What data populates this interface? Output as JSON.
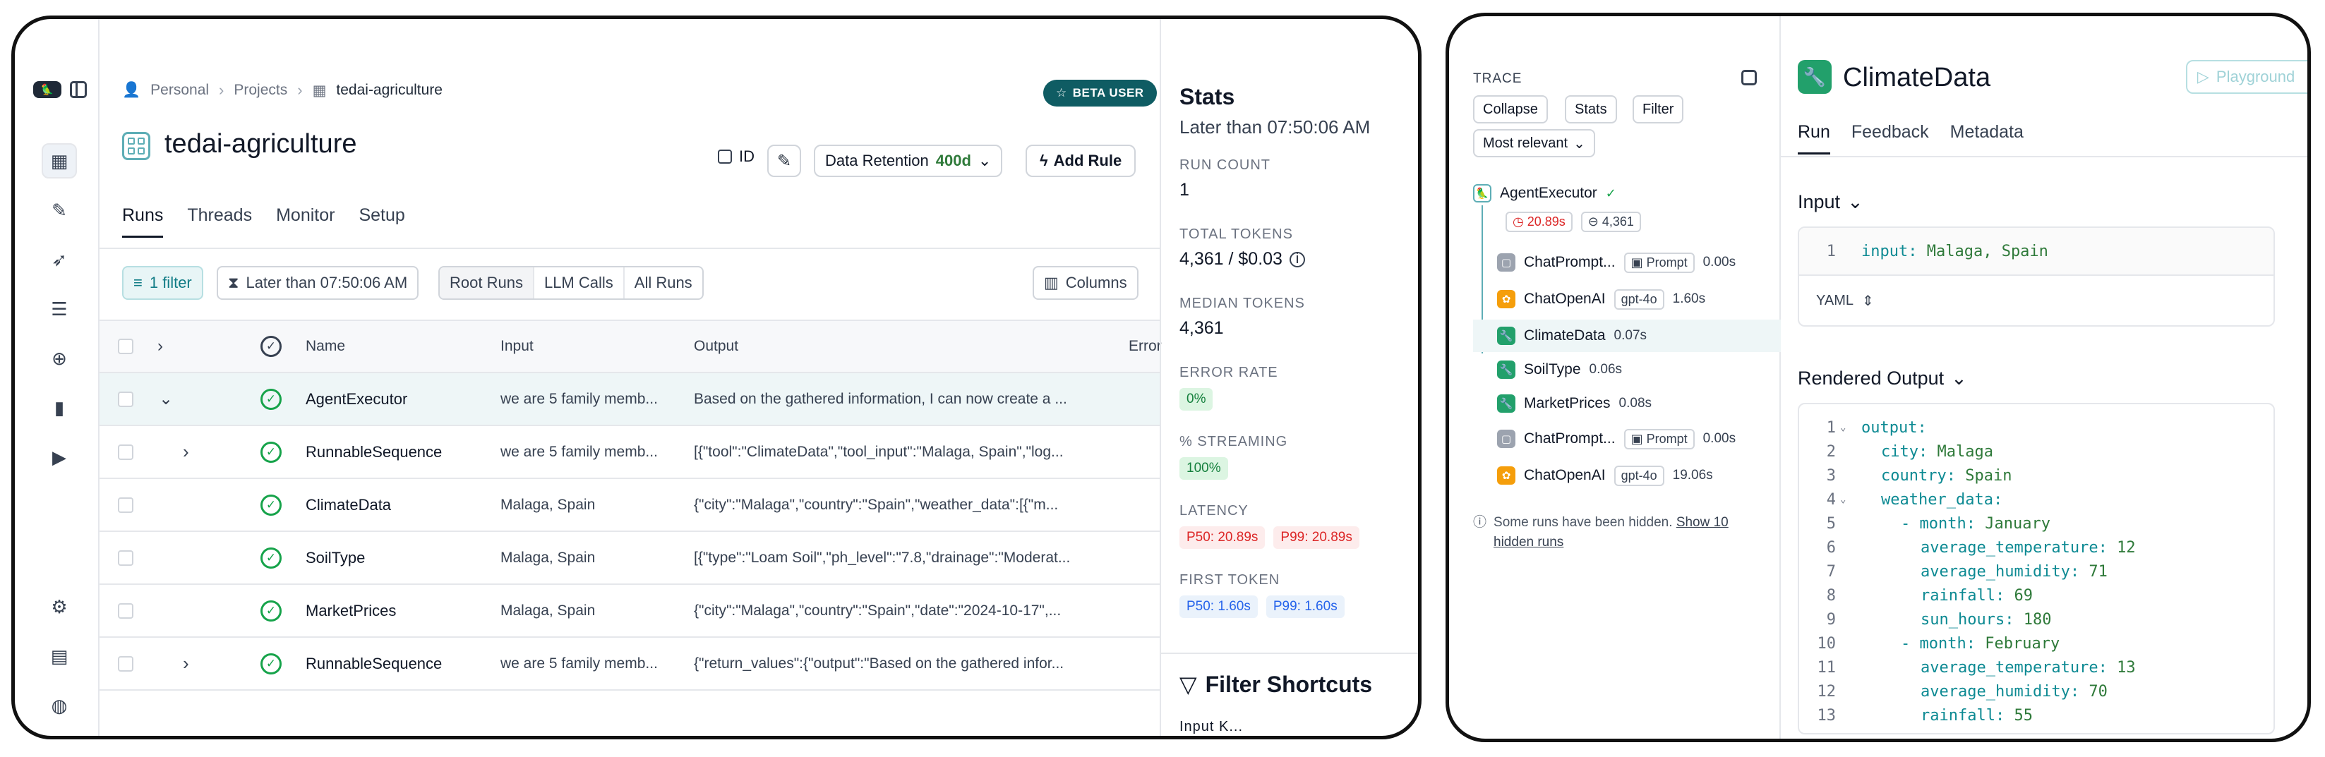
{
  "left": {
    "rail": {
      "logo": "🦜",
      "icons": [
        "grid-icon",
        "pen-icon",
        "rocket-icon",
        "database-icon",
        "chat-plus-icon",
        "chart-icon",
        "play-icon"
      ],
      "bottom_icons": [
        "settings-icon",
        "document-icon",
        "globe-icon"
      ]
    },
    "breadcrumb": [
      "Personal",
      "Projects",
      "tedai-agriculture"
    ],
    "beta_badge": "BETA USER",
    "project_title": "tedai-agriculture",
    "header_actions": {
      "id_label": "ID",
      "retention_label": "Data Retention",
      "retention_value": "400d",
      "add_rule": "Add Rule"
    },
    "tabs": [
      "Runs",
      "Threads",
      "Monitor",
      "Setup"
    ],
    "filters": {
      "filter_count": "1 filter",
      "time_filter": "Later than 07:50:06 AM",
      "segments": [
        "Root Runs",
        "LLM Calls",
        "All Runs"
      ],
      "columns": "Columns"
    },
    "table": {
      "headers": {
        "name": "Name",
        "input": "Input",
        "output": "Output",
        "error": "Error"
      },
      "rows": [
        {
          "name": "AgentExecutor",
          "input": "we are 5 family memb...",
          "output": "Based on the gathered information, I can now create a ...",
          "expand": "⌄"
        },
        {
          "name": "RunnableSequence",
          "input": "we are 5 family memb...",
          "output": "[{\"tool\":\"ClimateData\",\"tool_input\":\"Malaga, Spain\",\"log...",
          "expand": "›"
        },
        {
          "name": "ClimateData",
          "input": "Malaga, Spain",
          "output": "{\"city\":\"Malaga\",\"country\":\"Spain\",\"weather_data\":[{\"m...",
          "expand": ""
        },
        {
          "name": "SoilType",
          "input": "Malaga, Spain",
          "output": "[{\"type\":\"Loam Soil\",\"ph_level\":\"7.8,\"drainage\":\"Moderat...",
          "expand": ""
        },
        {
          "name": "MarketPrices",
          "input": "Malaga, Spain",
          "output": "{\"city\":\"Malaga\",\"country\":\"Spain\",\"date\":\"2024-10-17\",...",
          "expand": ""
        },
        {
          "name": "RunnableSequence",
          "input": "we are 5 family memb...",
          "output": "{\"return_values\":{\"output\":\"Based on the gathered infor...",
          "expand": "›"
        }
      ]
    },
    "stats": {
      "title": "Stats",
      "subtitle": "Later than 07:50:06 AM",
      "run_count_label": "RUN COUNT",
      "run_count": "1",
      "total_tokens_label": "TOTAL TOKENS",
      "total_tokens": "4,361 / $0.03",
      "median_tokens_label": "MEDIAN TOKENS",
      "median_tokens": "4,361",
      "error_rate_label": "ERROR RATE",
      "error_rate": "0%",
      "streaming_label": "% STREAMING",
      "streaming": "100%",
      "latency_label": "LATENCY",
      "latency_p50": "P50: 20.89s",
      "latency_p99": "P99: 20.89s",
      "first_token_label": "FIRST TOKEN",
      "first_token_p50": "P50: 1.60s",
      "first_token_p99": "P99: 1.60s",
      "filter_shortcuts": "Filter Shortcuts",
      "cut_off": "Input K..."
    }
  },
  "right": {
    "trace": {
      "title": "TRACE",
      "buttons": [
        "Collapse",
        "Stats",
        "Filter"
      ],
      "sort": "Most relevant",
      "root": {
        "name": "AgentExecutor",
        "time": "20.89s",
        "tokens": "4,361"
      },
      "nodes": [
        {
          "name": "ChatPrompt...",
          "tag": "Prompt",
          "dur": "0.00s",
          "icon": "gray"
        },
        {
          "name": "ChatOpenAI",
          "tag": "gpt-4o",
          "dur": "1.60s",
          "icon": "orange"
        },
        {
          "name": "ClimateData",
          "tag": "",
          "dur": "0.07s",
          "icon": "green"
        },
        {
          "name": "SoilType",
          "tag": "",
          "dur": "0.06s",
          "icon": "green"
        },
        {
          "name": "MarketPrices",
          "tag": "",
          "dur": "0.08s",
          "icon": "green"
        },
        {
          "name": "ChatPrompt...",
          "tag": "Prompt",
          "dur": "0.00s",
          "icon": "gray"
        },
        {
          "name": "ChatOpenAI",
          "tag": "gpt-4o",
          "dur": "19.06s",
          "icon": "orange"
        }
      ],
      "hidden_note": "Some runs have been hidden.",
      "hidden_link": "Show 10 hidden runs"
    },
    "detail": {
      "title": "ClimateData",
      "playground": "Playground",
      "tabs": [
        "Run",
        "Feedback",
        "Metadata"
      ],
      "input_header": "Input",
      "input_line": {
        "num": "1",
        "key": "input",
        "value": "Malaga, Spain"
      },
      "yaml_label": "YAML",
      "output_header": "Rendered Output",
      "output_lines": [
        {
          "num": "1",
          "fold": "⌄",
          "indent": 0,
          "key": "output",
          "value": ""
        },
        {
          "num": "2",
          "fold": "",
          "indent": 1,
          "key": "city",
          "value": "Malaga"
        },
        {
          "num": "3",
          "fold": "",
          "indent": 1,
          "key": "country",
          "value": "Spain"
        },
        {
          "num": "4",
          "fold": "⌄",
          "indent": 1,
          "key": "weather_data",
          "value": ""
        },
        {
          "num": "5",
          "fold": "",
          "indent": 2,
          "dash": true,
          "key": "month",
          "value": "January"
        },
        {
          "num": "6",
          "fold": "",
          "indent": 3,
          "key": "average_temperature",
          "value": "12"
        },
        {
          "num": "7",
          "fold": "",
          "indent": 3,
          "key": "average_humidity",
          "value": "71"
        },
        {
          "num": "8",
          "fold": "",
          "indent": 3,
          "key": "rainfall",
          "value": "69"
        },
        {
          "num": "9",
          "fold": "",
          "indent": 3,
          "key": "sun_hours",
          "value": "180"
        },
        {
          "num": "10",
          "fold": "",
          "indent": 2,
          "dash": true,
          "key": "month",
          "value": "February"
        },
        {
          "num": "11",
          "fold": "",
          "indent": 3,
          "key": "average_temperature",
          "value": "13"
        },
        {
          "num": "12",
          "fold": "",
          "indent": 3,
          "key": "average_humidity",
          "value": "70"
        },
        {
          "num": "13",
          "fold": "",
          "indent": 3,
          "key": "rainfall",
          "value": "55"
        }
      ]
    }
  }
}
